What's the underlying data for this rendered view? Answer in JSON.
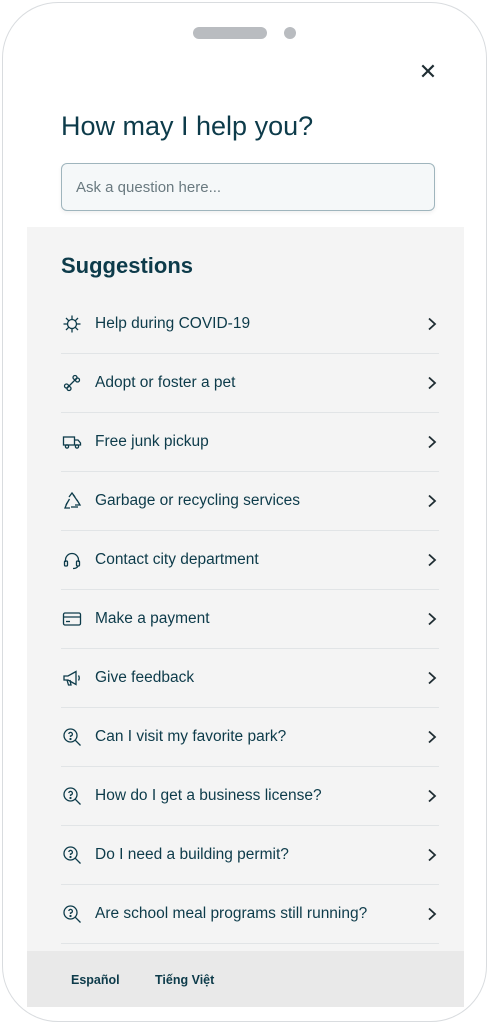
{
  "header": {
    "close_icon": "close-icon",
    "title": "How may I help you?"
  },
  "search": {
    "placeholder": "Ask a question here..."
  },
  "suggestions": {
    "heading": "Suggestions",
    "items": [
      {
        "label": "Help during COVID-19",
        "icon": "virus-icon"
      },
      {
        "label": "Adopt or foster a pet",
        "icon": "bone-icon"
      },
      {
        "label": "Free junk pickup",
        "icon": "truck-icon"
      },
      {
        "label": "Garbage or recycling services",
        "icon": "recycle-icon"
      },
      {
        "label": "Contact city department",
        "icon": "headset-icon"
      },
      {
        "label": "Make a payment",
        "icon": "credit-card-icon"
      },
      {
        "label": "Give feedback",
        "icon": "megaphone-icon"
      },
      {
        "label": "Can I visit my favorite park?",
        "icon": "search-question-icon"
      },
      {
        "label": "How do I get a business license?",
        "icon": "search-question-icon"
      },
      {
        "label": "Do I need a building permit?",
        "icon": "search-question-icon"
      },
      {
        "label": "Are school meal programs still running?",
        "icon": "search-question-icon"
      }
    ]
  },
  "footer": {
    "languages": [
      "Español",
      "Tiếng Việt"
    ]
  },
  "colors": {
    "text": "#0d3b4a",
    "panel_bg": "#f4f4f4",
    "footer_bg": "#e9e9e9",
    "input_border": "#9fb5bd"
  }
}
